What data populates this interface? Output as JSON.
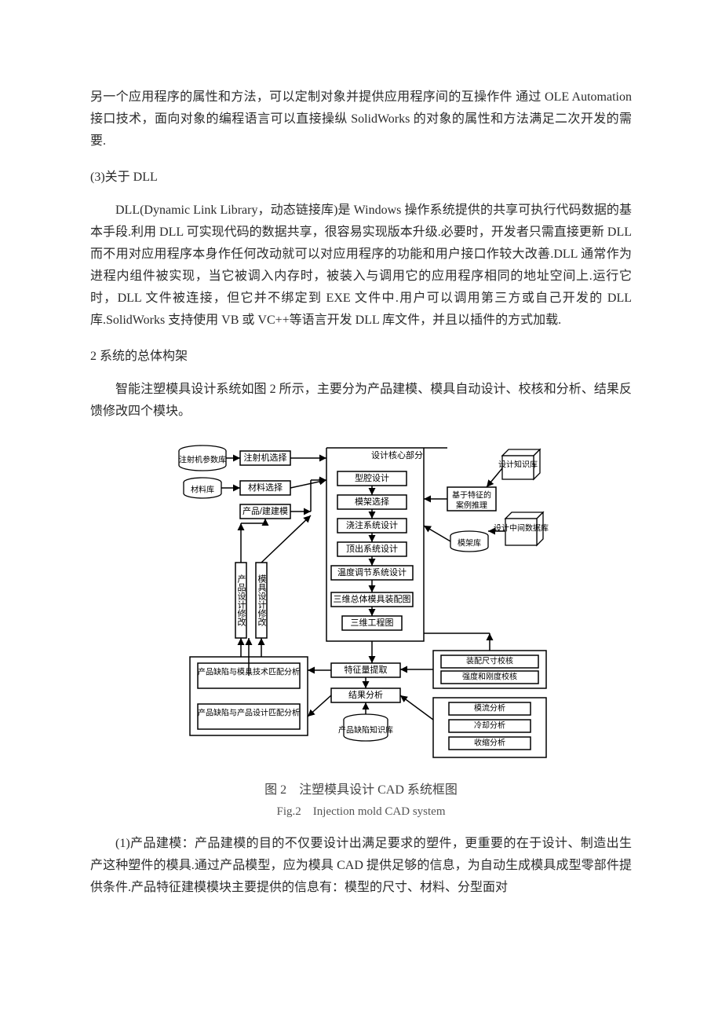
{
  "para1": "另一个应用程序的属性和方法，可以定制对象并提供应用程序间的互操作件 通过 OLE Automation 接口技术，面向对象的编程语言可以直接操纵 SolidWorks 的对象的属性和方法满足二次开发的需要.",
  "head1": "(3)关于 DLL",
  "para2": "DLL(Dynamic Link Library，动态链接库)是 Windows 操作系统提供的共享可执行代码数据的基本手段.利用 DLL 可实现代码的数据共享，很容易实现版本升级.必要时，开发者只需直接更新 DLL 而不用对应用程序本身作任何改动就可以对应用程序的功能和用户接口作较大改善.DLL 通常作为进程内组件被实现，当它被调入内存时，被装入与调用它的应用程序相同的地址空间上.运行它时，DLL 文件被连接，但它并不绑定到 EXE 文件中.用户可以调用第三方或自己开发的 DLL 库.SolidWorks 支持使用 VB 或 VC++等语言开发 DLL 库文件，并且以插件的方式加载.",
  "head2": "2 系统的总体构架",
  "para3": "智能注塑模具设计系统如图 2 所示，主要分为产品建模、模具自动设计、校核和分析、结果反馈修改四个模块。",
  "para4": "(1)产品建模：产品建模的目的不仅要设计出满足要求的塑件，更重要的在于设计、制造出生产这种塑件的模具.通过产品模型，应为模具 CAD 提供足够的信息，为自动生成模具成型零部件提供条件.产品特征建模模块主要提供的信息有：模型的尺寸、材料、分型面对",
  "fig": {
    "db_inj": "注射机参数库",
    "db_mat": "材料库",
    "db_know": "设计知识库",
    "db_mid": "设计中间数据库",
    "db_mold": "模架库",
    "db_defect": "产品缺陷知识库",
    "sel_inj": "注射机选择",
    "sel_mat": "材料选择",
    "prod_model": "产品/建建模",
    "core_title": "设计核心部分",
    "c_type": "型腔设计",
    "c_frame": "模架选择",
    "c_pour": "浇注系统设计",
    "c_eject": "顶出系统设计",
    "c_temp": "温度调节系统设计",
    "c_asm": "三维总体模具装配图",
    "c_eng": "三维工程图",
    "cbr1": "基于特征的",
    "cbr2": "案例推理",
    "v_prod": "产品设计修改",
    "v_mold": "模具设计修改",
    "bl_match": "产品缺陷与模具技术匹配分析",
    "bl_design": "产品缺陷与产品设计匹配分析",
    "feat_ext": "特征量提取",
    "res_ana": "结果分析",
    "chk_fit": "装配尺寸校核",
    "chk_str": "强度和刚度校核",
    "ana_mold": "模流分析",
    "ana_cool": "冷却分析",
    "ana_shrink": "收缩分析",
    "caption_cn": "图 2　注塑模具设计 CAD 系统框图",
    "caption_en": "Fig.2　Injection mold CAD system"
  },
  "chart_data": {
    "type": "diagram",
    "title": "注塑模具设计 CAD 系统框图",
    "title_en": "Injection mold CAD system",
    "inputs": {
      "databases": [
        "注射机参数库",
        "材料库"
      ],
      "selectors": [
        "注射机选择",
        "材料选择"
      ],
      "modeling": "产品/建建模"
    },
    "design_core": {
      "label": "设计核心部分",
      "steps": [
        "型腔设计",
        "模架选择",
        "浇注系统设计",
        "顶出系统设计",
        "温度调节系统设计",
        "三维总体模具装配图",
        "三维工程图"
      ],
      "supports": {
        "knowledge_db": "设计知识库",
        "cbr": "基于特征的案例推理",
        "mold_library": "模架库",
        "mid_db": "设计中间数据库"
      }
    },
    "feedback_loops": [
      "产品设计修改",
      "模具设计修改"
    ],
    "defect_analysis": {
      "modules": [
        "产品缺陷与模具技术匹配分析",
        "产品缺陷与产品设计匹配分析"
      ],
      "flow": [
        "特征量提取",
        "结果分析"
      ],
      "knowledge_db": "产品缺陷知识库"
    },
    "check_and_analysis": {
      "checks": [
        "装配尺寸校核",
        "强度和刚度校核"
      ],
      "analyses": [
        "模流分析",
        "冷却分析",
        "收缩分析"
      ]
    }
  }
}
